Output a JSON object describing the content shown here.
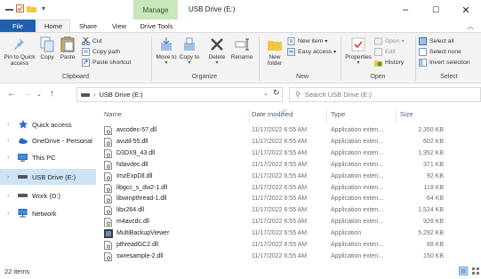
{
  "window": {
    "title": "USB Drive (E:)",
    "manage_tab": "Manage",
    "controls": {
      "minimize": "–",
      "maximize": "☐",
      "close": "✕"
    }
  },
  "ribbon_tabs": {
    "file": "File",
    "home": "Home",
    "share": "Share",
    "view": "View",
    "drive_tools": "Drive Tools"
  },
  "ribbon": {
    "clipboard": {
      "pin": "Pin to Quick access",
      "copy": "Copy",
      "paste": "Paste",
      "cut": "Cut",
      "copy_path": "Copy path",
      "paste_shortcut": "Paste shortcut",
      "group": "Clipboard"
    },
    "organize": {
      "move_to": "Move to",
      "copy_to": "Copy to",
      "delete": "Delete",
      "rename": "Rename",
      "group": "Organize"
    },
    "new": {
      "new_folder": "New folder",
      "new_item": "New item",
      "easy_access": "Easy access",
      "group": "New"
    },
    "open": {
      "properties": "Properties",
      "open": "Open",
      "edit": "Edit",
      "history": "History",
      "group": "Open"
    },
    "select": {
      "select_all": "Select all",
      "select_none": "Select none",
      "invert": "Invert selection",
      "group": "Select"
    }
  },
  "address": {
    "path": "USB Drive (E:)",
    "search_placeholder": "Search USB Drive (E:)"
  },
  "nav": [
    {
      "label": "Quick access",
      "icon": "star-icon"
    },
    {
      "label": "OneDrive - Personal",
      "icon": "cloud-icon"
    },
    {
      "label": "This PC",
      "icon": "monitor-icon"
    },
    {
      "label": "USB Drive (E:)",
      "icon": "drive-icon"
    },
    {
      "label": "Work (D:)",
      "icon": "drive-icon"
    },
    {
      "label": "Network",
      "icon": "network-icon"
    }
  ],
  "columns": {
    "name": "Name",
    "date": "Date modified",
    "type": "Type",
    "size": "Size"
  },
  "files": [
    {
      "name": "avcodec-57.dll",
      "date": "11/17/2022 6:55 AM",
      "type": "Application exten...",
      "size": "2,350 KB",
      "icon": "dll-file-icon"
    },
    {
      "name": "avutil-55.dll",
      "date": "11/17/2022 6:55 AM",
      "type": "Application exten...",
      "size": "602 KB",
      "icon": "dll-file-icon"
    },
    {
      "name": "D3DX9_43.dll",
      "date": "11/17/2022 6:55 AM",
      "type": "Application exten...",
      "size": "1,952 KB",
      "icon": "dll-file-icon"
    },
    {
      "name": "hdavdec.dll",
      "date": "11/17/2022 6:55 AM",
      "type": "Application exten...",
      "size": "371 KB",
      "icon": "dll-file-icon"
    },
    {
      "name": "ImzExpDll.dll",
      "date": "11/17/2022 6:55 AM",
      "type": "Application exten...",
      "size": "92 KB",
      "icon": "dll-file-icon"
    },
    {
      "name": "libgcc_s_dw2-1.dll",
      "date": "11/17/2022 6:55 AM",
      "type": "Application exten...",
      "size": "118 KB",
      "icon": "dll-file-icon"
    },
    {
      "name": "libwinpthread-1.dll",
      "date": "11/17/2022 6:55 AM",
      "type": "Application exten...",
      "size": "64 KB",
      "icon": "dll-file-icon"
    },
    {
      "name": "libx264.dll",
      "date": "11/17/2022 6:55 AM",
      "type": "Application exten...",
      "size": "1,524 KB",
      "icon": "dll-file-icon"
    },
    {
      "name": "m4avcdc.dll",
      "date": "11/17/2022 6:55 AM",
      "type": "Application exten...",
      "size": "928 KB",
      "icon": "dll-file-icon"
    },
    {
      "name": "MultiBackupViewer",
      "date": "11/17/2022 6:55 AM",
      "type": "Application",
      "size": "5,292 KB",
      "icon": "app-icon"
    },
    {
      "name": "pthreadGC2.dll",
      "date": "11/17/2022 6:55 AM",
      "type": "Application exten...",
      "size": "88 KB",
      "icon": "dll-file-icon"
    },
    {
      "name": "swresample-2.dll",
      "date": "11/17/2022 6:55 AM",
      "type": "Application exten...",
      "size": "150 KB",
      "icon": "dll-file-icon"
    }
  ],
  "status": {
    "count": "22 items"
  },
  "colors": {
    "accent": "#1f5fae",
    "manage": "#c9e7bb",
    "selected": "#cce4f7"
  }
}
